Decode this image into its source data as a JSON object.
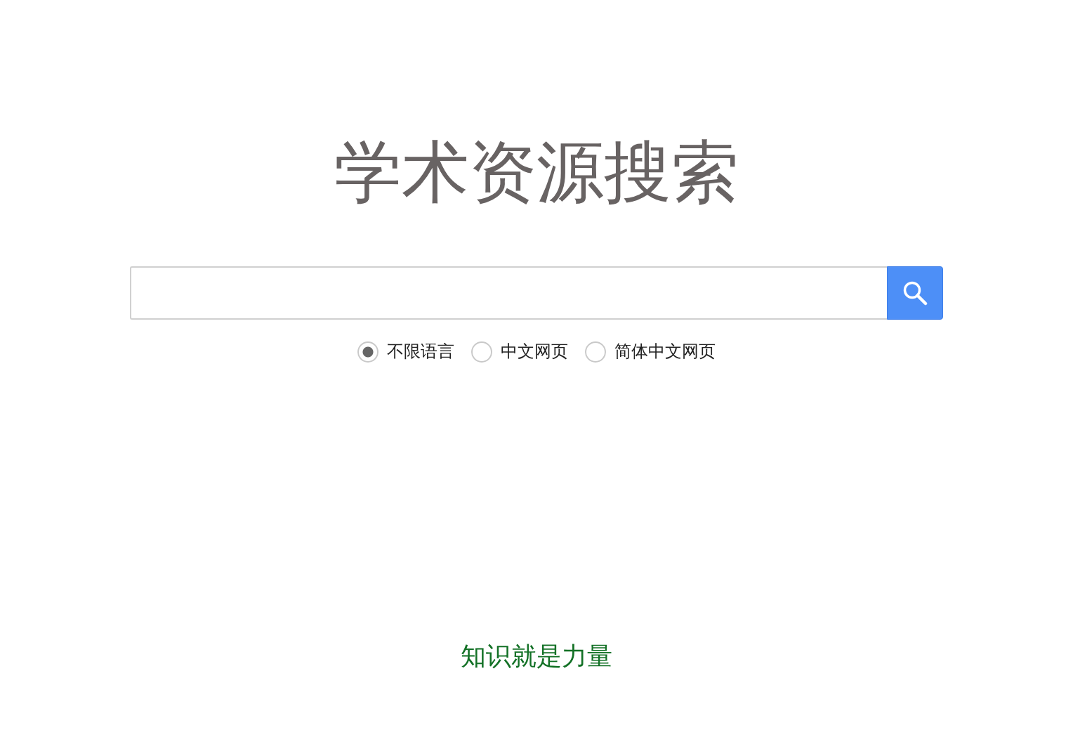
{
  "title": "学术资源搜索",
  "language_options": [
    {
      "label": "不限语言",
      "selected": true
    },
    {
      "label": "中文网页",
      "selected": false
    },
    {
      "label": "简体中文网页",
      "selected": false
    }
  ],
  "footer": "知识就是力量"
}
